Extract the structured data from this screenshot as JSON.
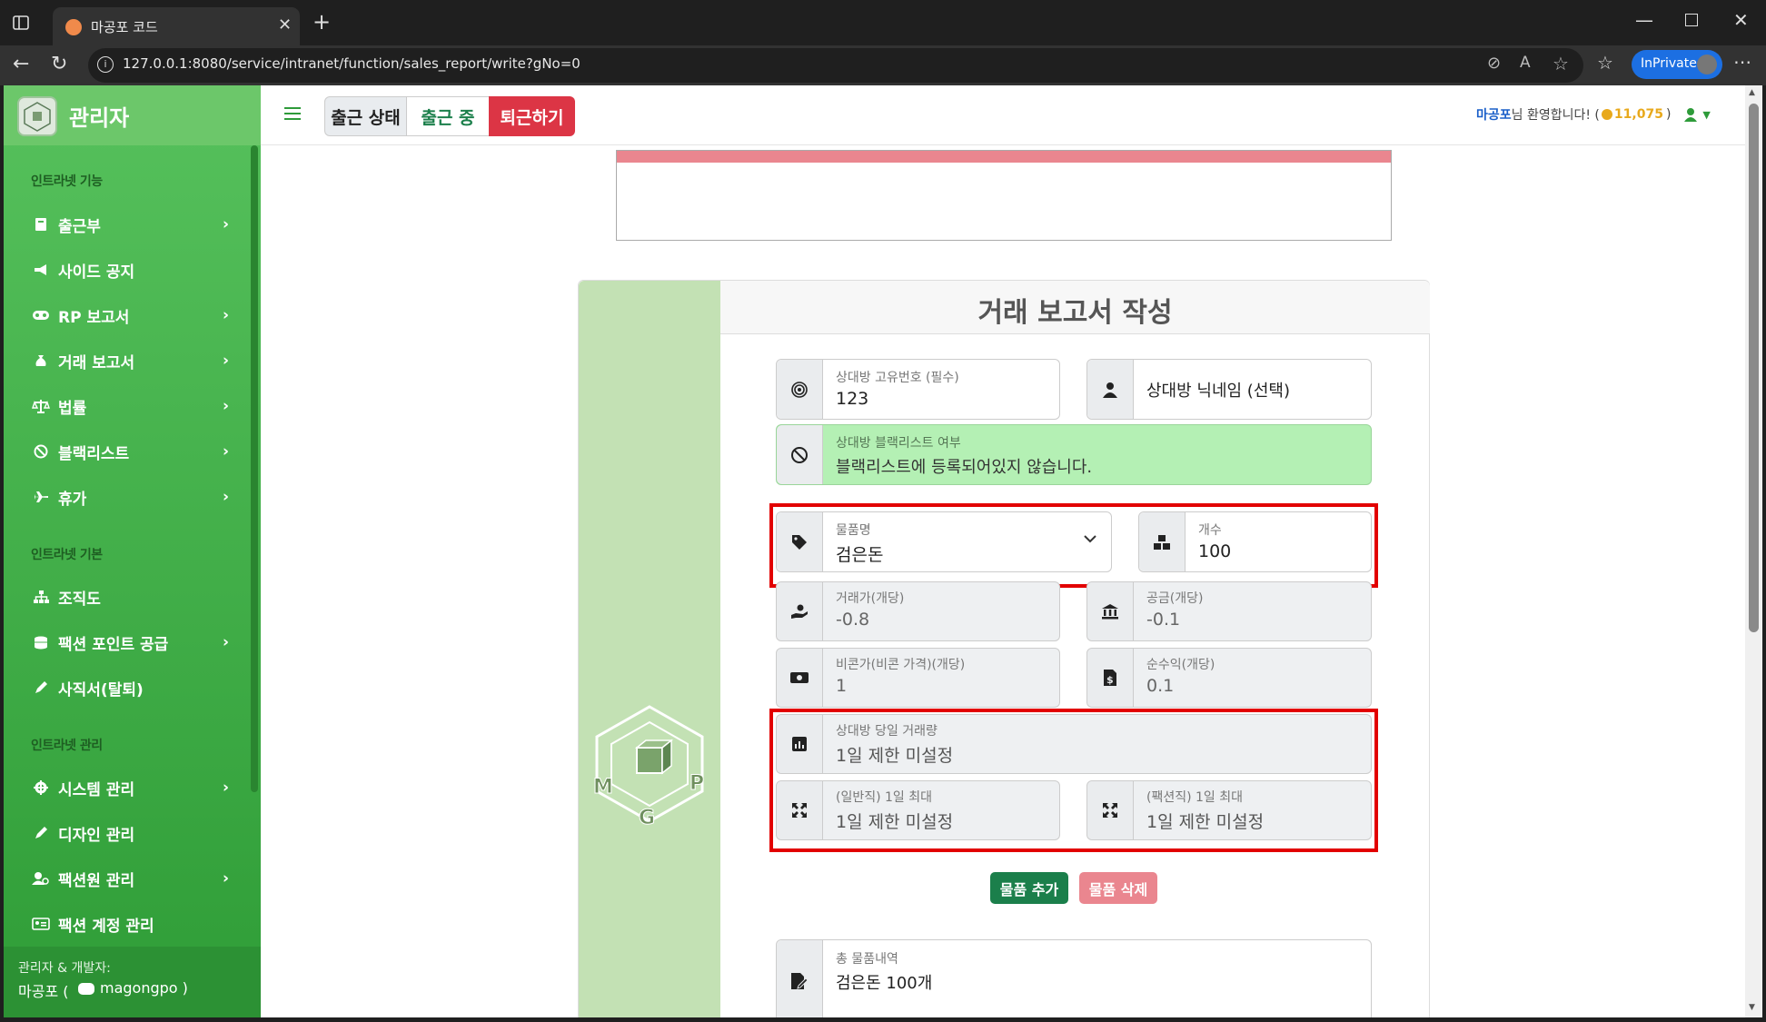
{
  "browser": {
    "tab_title": "마공포 코드",
    "url": "127.0.0.1:8080/service/intranet/function/sales_report/write?gNo=0",
    "inprivate_label": "InPrivate"
  },
  "sidebar": {
    "brand": "관리자",
    "sections": [
      "인트라넷 기능",
      "인트라넷 기본",
      "인트라넷 관리"
    ],
    "items": [
      {
        "label": "출근부",
        "icon": "book-icon"
      },
      {
        "label": "사이드 공지",
        "icon": "megaphone-icon"
      },
      {
        "label": "RP 보고서",
        "icon": "gamepad-icon"
      },
      {
        "label": "거래 보고서",
        "icon": "money-bag-icon"
      },
      {
        "label": "법률",
        "icon": "scale-icon"
      },
      {
        "label": "블랙리스트",
        "icon": "ban-icon"
      },
      {
        "label": "휴가",
        "icon": "plane-icon"
      },
      {
        "label": "조직도",
        "icon": "sitemap-icon"
      },
      {
        "label": "팩션 포인트 공급",
        "icon": "coins-icon"
      },
      {
        "label": "사직서(탈퇴)",
        "icon": "pen-icon"
      },
      {
        "label": "시스템 관리",
        "icon": "gear-icon"
      },
      {
        "label": "디자인 관리",
        "icon": "brush-icon"
      },
      {
        "label": "팩션원 관리",
        "icon": "users-icon"
      },
      {
        "label": "팩션 계정 관리",
        "icon": "id-card-icon"
      }
    ],
    "footer_title": "관리자 & 개발자:",
    "footer_name": "마공포 (",
    "footer_discord": "magongpo )"
  },
  "topbar": {
    "status_label": "출근 상태",
    "status_value": "출근 중",
    "leave_button": "퇴근하기",
    "welcome_name": "마공포",
    "welcome_text": "님 환영합니다! (",
    "points": "11,075",
    "points_close": ")"
  },
  "form": {
    "title": "거래 보고서 작성",
    "uid_label": "상대방 고유번호 (필수)",
    "uid_value": "123",
    "nick_placeholder": "상대방 닉네임 (선택)",
    "blacklist_label": "상대방 블랙리스트 여부",
    "blacklist_value": "블랙리스트에 등록되어있지 않습니다.",
    "item_label": "물품명",
    "item_value": "검은돈",
    "count_label": "개수",
    "count_value": "100",
    "trade_label": "거래가(개당)",
    "trade_value": "-0.8",
    "supply_label": "공금(개당)",
    "supply_value": "-0.1",
    "beacon_label": "비콘가(비콘 가격)(개당)",
    "beacon_value": "1",
    "profit_label": "순수익(개당)",
    "profit_value": "0.1",
    "daily_label": "상대방 당일 거래량",
    "daily_value": "1일 제한 미설정",
    "normal_label": "(일반직) 1일 최대",
    "normal_value": "1일 제한 미설정",
    "faction_label": "(팩션직) 1일 최대",
    "faction_value": "1일 제한 미설정",
    "add_button": "물품 추가",
    "delete_button": "물품 삭제",
    "total_label": "총 물품내역",
    "total_value": "검은돈 100개"
  },
  "colors": {
    "green": "#1b7f4b",
    "red": "#dc3545",
    "pink": "#ea868f",
    "blacklist_bg": "#b4f0b4",
    "brand_green": "#4cb850"
  }
}
